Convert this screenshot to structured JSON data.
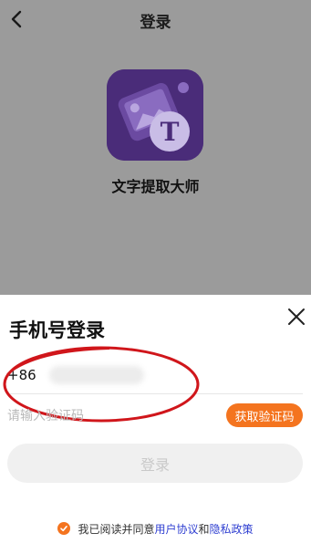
{
  "header": {
    "title": "登录",
    "back_icon": "chevron-left-icon"
  },
  "app": {
    "name": "文字提取大师",
    "logo_letter": "T",
    "logo_color": "#4a2c79"
  },
  "sheet": {
    "title": "手机号登录",
    "close_icon": "close-icon",
    "phone": {
      "country_code": "+86",
      "value": ""
    },
    "code": {
      "placeholder": "请输入验证码",
      "get_code_label": "获取验证码"
    },
    "login_label": "登录",
    "agreement": {
      "prefix": "我已阅读并同意",
      "user_agreement": "用户协议",
      "and": "和",
      "privacy_policy": "隐私政策",
      "checked": true
    }
  },
  "colors": {
    "accent": "#f4741f",
    "link": "#2f3fd1",
    "annotation": "#d0161b"
  }
}
